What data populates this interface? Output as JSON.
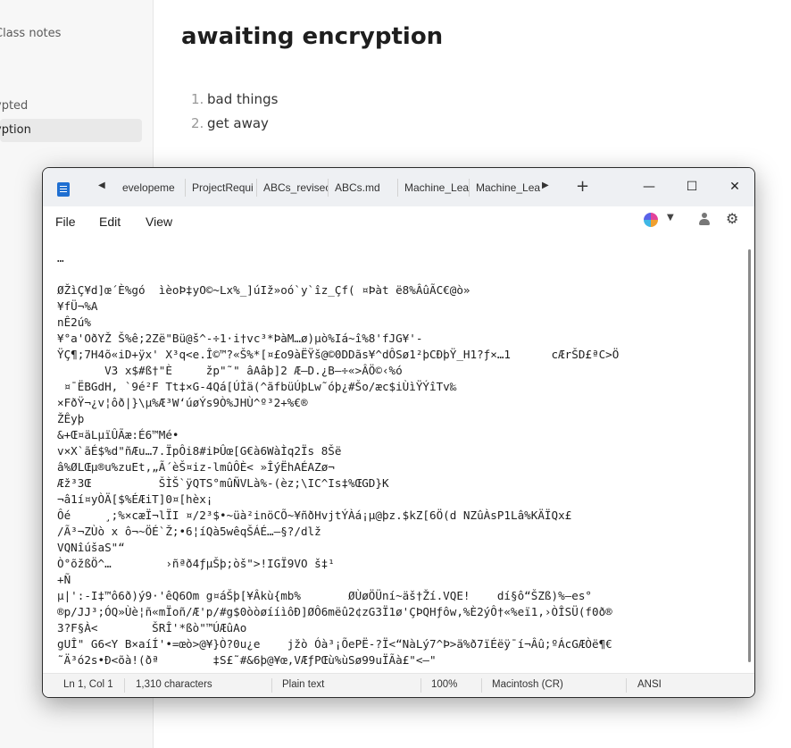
{
  "background_app": {
    "sidebar": {
      "items": [
        {
          "label": "Class notes"
        },
        {
          "label": "ypted"
        },
        {
          "label": "yption"
        }
      ]
    },
    "page_title": "awaiting encryption",
    "list": [
      {
        "num": "1.",
        "text": "bad things"
      },
      {
        "num": "2.",
        "text": "get away"
      }
    ]
  },
  "notepad": {
    "tabs": [
      {
        "label": "evelopeme"
      },
      {
        "label": "ProjectRequi"
      },
      {
        "label": "ABCs_revisec"
      },
      {
        "label": "ABCs.md"
      },
      {
        "label": "Machine_Lea"
      },
      {
        "label": "Machine_Lea"
      }
    ],
    "new_tab": "+",
    "window_controls": {
      "minimize": "—",
      "maximize": "☐",
      "close": "✕"
    },
    "menu": {
      "file": "File",
      "edit": "Edit",
      "view": "View"
    },
    "icons": [
      "notepad-icon",
      "copilot-icon",
      "account-icon",
      "settings-gear-icon"
    ],
    "content": "…\n\nØŽìÇ¥d]œ´È%gó  ìèoÞ‡yO©~Lx%_]úIž»oó`y`îz_Çf( ¤Þàt ë8%ÂûÃC€@ò»\n¥fÜ¬%A\nnÊ2ú%\n¥°a'OðYŽ Š%ê;2Zë\"Bü@š^-÷1·i†vc³*ÞàM…ø)µò%Iá~î%8'fJG¥'-\nŸÇ¶;7H4õ«iD+ÿx' X³q<e.Î©™?«Š%*[¤£o9àËŸš@©0DDãs¥^dÔSø1²þCÐþŸ_H1?ƒ×…1      cÆrŠD£ªC>Ö\n       V3 x$#ß†\"È     žp\"˜\" âAâþ]2 Æ—D.¿B—÷«>ÂÖ©‹%ó\n ¤¯ËBGdH, `9é²F Tt‡×G-4Qá[ÚÌä(^ãfbüÚþLw˜óþ¿#Šo/æc$iÙìŸÝîTv‰\n×FðŸ¬¿v¦ôð|}\\µ%Æ³W‘úøÝs9Ò%JHÙ^º³2+%€®\nŽÊyþ\n&+Œ¤äLµïÛÃæ:É6™Mé•\nv×X`ãÉ$%d\"ñÆu…7.ÏpÔi8#iÞÛœ[G€à6WàÌq2Ïs 8Šë\nâ%ØLŒµ®u%zuEt,„Ã´èŠ¤iz-lmûÔÈ< »ÎýËhAÉAZø¬\nÆž³3Œ          ŠÌŠ`ÿQTS°mûÑVLà%-(èz;\\IC^Is‡%ŒGD}K\n¬â1í¤yÒÄ[$%ÉÆiT]0¤[hèx¡\nÔé     ¸;%×cæÏ¬lÏI ¤/2³$•~üà²inöCÕ~¥ñðHvjtÝÀá¡µ@þz.$kZ[6Ö(d NZûÀsP1Lâ%KÄÏQx£\n/Ã³¬ZÙò x ô¬~ÖÉ`Ž;•6¦íQà5wêqŠÁÉ…—§?/dlž\nVQNîúšaS\"“\nÒ°õžßÖ^…        ›ñªð4ƒµŠþ;òš\">!IGÏ9VO š‡¹\n+Ñ\nµ|':-I‡™ô6ð)ý9·'êQ6Om g¤áŠþ[¥Âkù{mb%       ØÙøÖÜní~äš†Ží.VQE!    dí§ô“ŠZß)%–es°\n®p/JJ³;ÓQ»Ùè¦ñ«mÏoñ/Æ'p/#g$0òòøííìôÐ]ØÔ6mëû2¢zG3Ï1ø'ÇÞQHƒôw,%È2ýÔ†«%eï1,›ÒÎSÜ(f0ð®\n3?F§À<        ŠRÎ'*ßò\"™ÚÆûAo\ngUÎ\" G6<Y B×aíÍ'•=œò>@¥}Ò?0u¿e    jžò Óà³¡ÕePË-?Ï<“NàLý7^Þ>ä%ð7ïÉëÿ¯í¬Âû;ºÁcGÆÒë¶€\n˜Ä³ó2s•Ð<õà!(ðª        ‡S£˜#&6þ@¥œ,VÆƒPŒù%ùSø99uÏÃà£\"<–\""
  },
  "status_bar": {
    "position": "Ln 1, Col 1",
    "characters": "1,310 characters",
    "format": "Plain text",
    "zoom": "100%",
    "line_ending": "Macintosh (CR)",
    "encoding": "ANSI"
  }
}
